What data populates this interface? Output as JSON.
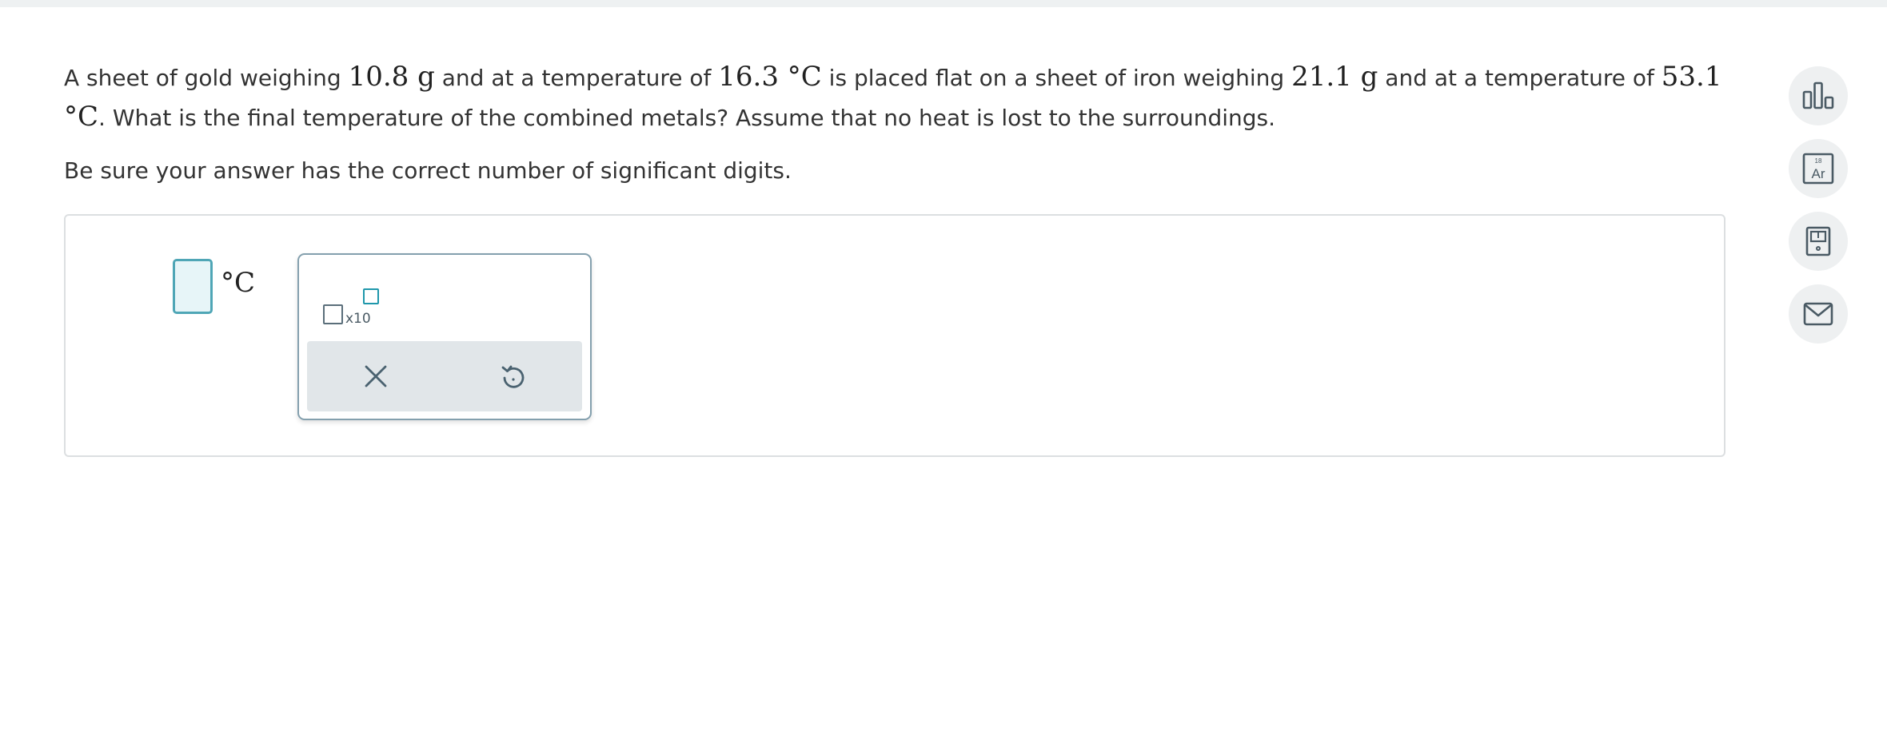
{
  "question": {
    "t1": "A sheet of gold weighing ",
    "m1": "10.8 g",
    "t2": " and at a temperature of ",
    "m2": "16.3 °C",
    "t3": " is placed flat on a sheet of iron weighing ",
    "m3": "21.1 g",
    "t4": " and at a temperature of ",
    "m4": "53.1 °C",
    "t5": ". What is the final temperature of the combined metals? Assume that no heat is lost to the surroundings."
  },
  "instruction": "Be sure your answer has the correct number of significant digits.",
  "answer": {
    "value": "",
    "unit": "°C"
  },
  "sci_notation": {
    "label": "x10"
  },
  "periodic_table_icon": {
    "number": "18",
    "symbol": "Ar"
  },
  "icons": {
    "sidebar": [
      "bar-chart-icon",
      "periodic-table-icon",
      "calculator-icon",
      "mail-icon"
    ],
    "actions": [
      "close-icon",
      "undo-icon"
    ]
  },
  "colors": {
    "accent": "#1f97ab",
    "input_border": "#4fa6b6",
    "input_fill": "#e7f5f8",
    "icon": "#4a5a64"
  }
}
